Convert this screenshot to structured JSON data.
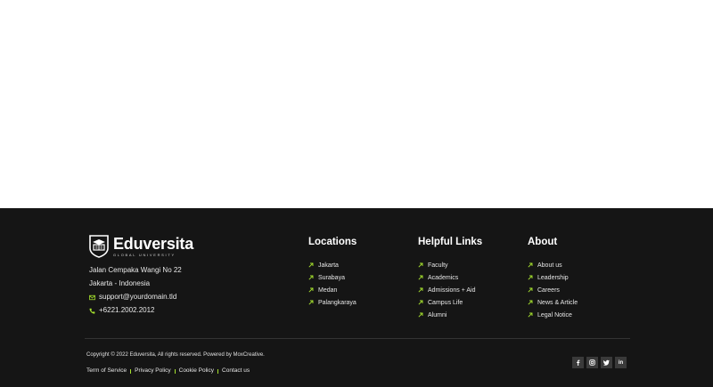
{
  "brand": {
    "name": "Eduversita",
    "tagline": "GLOBAL UNIVERSITY",
    "address_line1": "Jalan Cempaka Wangi No 22",
    "address_line2": "Jakarta - Indonesia",
    "email": "support@yourdomain.tld",
    "phone": "+6221.2002.2012"
  },
  "columns": {
    "locations": {
      "title": "Locations",
      "items": [
        "Jakarta",
        "Surabaya",
        "Medan",
        "Palangkaraya"
      ]
    },
    "helpful": {
      "title": "Helpful Links",
      "items": [
        "Faculty",
        "Academics",
        "Admissions + Aid",
        "Campus Life",
        "Alumni"
      ]
    },
    "about": {
      "title": "About",
      "items": [
        "About us",
        "Leadership",
        "Careers",
        "News & Article",
        "Legal Notice"
      ]
    }
  },
  "bottom": {
    "copyright": "Copyright © 2022 Eduversita, All rights reserved. Powered by MoxCreative.",
    "legal_links": [
      "Term of Service",
      "Privacy Policy",
      "Cookie Policy",
      "Contact us"
    ],
    "social": [
      "facebook-icon",
      "instagram-icon",
      "twitter-icon",
      "linkedin-icon"
    ],
    "social_linkedin_text": "in"
  },
  "colors": {
    "footer_bg": "#151515",
    "accent": "#a6e22e",
    "social_bg": "#3a3a3a"
  }
}
